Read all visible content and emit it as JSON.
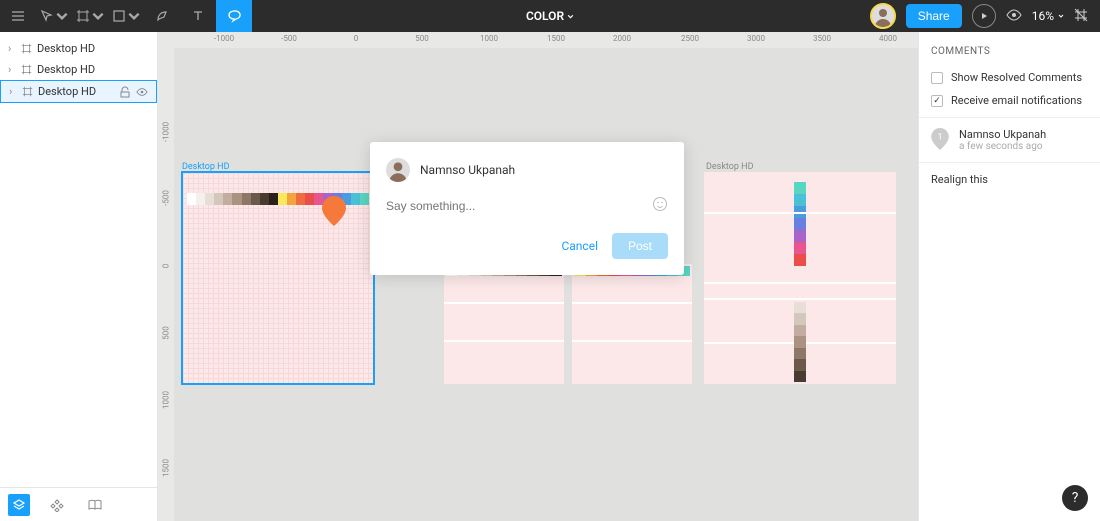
{
  "toolbar": {
    "title": "COLOR",
    "share": "Share",
    "zoom": "16%"
  },
  "layers": [
    {
      "name": "Desktop HD",
      "selected": false
    },
    {
      "name": "Desktop HD",
      "selected": false
    },
    {
      "name": "Desktop HD",
      "selected": true
    }
  ],
  "artboards": {
    "ab1": "Desktop HD",
    "ab2": "Desktop HD"
  },
  "comment_popup": {
    "author": "Namnso Ukpanah",
    "placeholder": "Say something...",
    "cancel": "Cancel",
    "post": "Post"
  },
  "right": {
    "title": "COMMENTS",
    "opt1": "Show Resolved Comments",
    "opt2": "Receive email notifications",
    "comment": {
      "num": "1",
      "author": "Namnso Ukpanah",
      "time": "a few seconds ago",
      "text": "Realign this"
    }
  },
  "rulers": {
    "h": [
      {
        "v": "-1000",
        "px": 50
      },
      {
        "v": "-500",
        "px": 115
      },
      {
        "v": "0",
        "px": 182
      },
      {
        "v": "500",
        "px": 248
      },
      {
        "v": "1000",
        "px": 315
      },
      {
        "v": "1500",
        "px": 382
      },
      {
        "v": "2000",
        "px": 448
      },
      {
        "v": "2500",
        "px": 516
      },
      {
        "v": "3000",
        "px": 582
      },
      {
        "v": "3500",
        "px": 648
      },
      {
        "v": "4000",
        "px": 714
      }
    ],
    "v": [
      {
        "v": "-1000",
        "px": 84
      },
      {
        "v": "-500",
        "px": 150
      },
      {
        "v": "0",
        "px": 218
      },
      {
        "v": "500",
        "px": 285
      },
      {
        "v": "1000",
        "px": 352
      },
      {
        "v": "1500",
        "px": 420
      }
    ]
  },
  "swatches_gray": [
    "#ffffff",
    "#f5f0ed",
    "#e8ded8",
    "#d6c7bd",
    "#c2ad9f",
    "#ab9382",
    "#8f7766",
    "#6d594b",
    "#4a3b31",
    "#2a211b"
  ],
  "swatches_color": [
    "#f7e85e",
    "#f4a43c",
    "#ee6c3e",
    "#e94e4a",
    "#e8568f",
    "#a764c9",
    "#6a7de0",
    "#4a9be0",
    "#4ac1d6",
    "#58d6c2"
  ],
  "help": "?"
}
